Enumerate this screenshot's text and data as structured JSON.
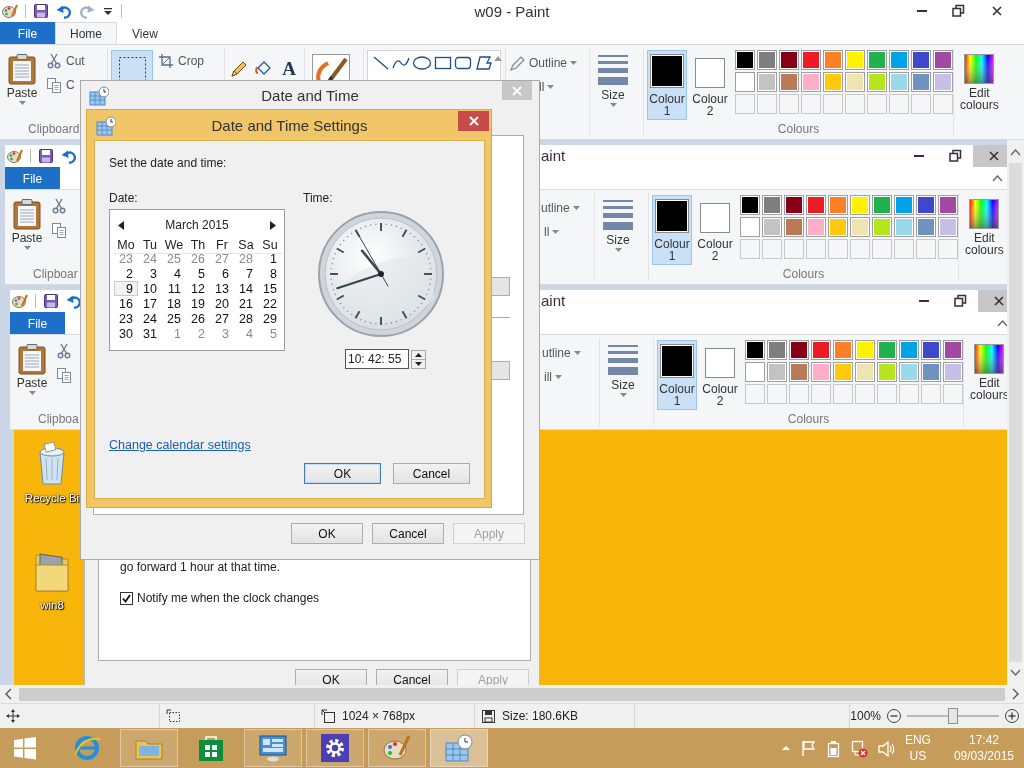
{
  "paint_window": {
    "title": "w09 - Paint",
    "tabs": [
      {
        "label": "File",
        "kind": "file",
        "selected": false
      },
      {
        "label": "Home",
        "kind": "tab",
        "selected": true
      },
      {
        "label": "View",
        "kind": "tab",
        "selected": false
      }
    ],
    "ribbon": {
      "paste": "Paste",
      "cut": "Cut",
      "copy": "C",
      "clipboard_label": "Clipboard",
      "select": {
        "selected": true
      },
      "crop": "Crop",
      "text_tool": "A",
      "outline": "Outline",
      "fill": "ll",
      "size": "Size",
      "colour_1": {
        "label": "Colour 1",
        "color": "#000000",
        "selected": true
      },
      "colour_2": {
        "label": "Colour 2",
        "color": "#ffffff",
        "selected": false
      },
      "edit_colours": "Edit colours",
      "colours_label": "Colours"
    }
  },
  "palette": [
    {
      "color": "#000000"
    },
    {
      "color": "#7f7f7f"
    },
    {
      "color": "#880015"
    },
    {
      "color": "#ed1c24"
    },
    {
      "color": "#ff7f27"
    },
    {
      "color": "#fff200"
    },
    {
      "color": "#22b14c"
    },
    {
      "color": "#00a2e8"
    },
    {
      "color": "#3f48cc"
    },
    {
      "color": "#a349a4"
    },
    {
      "color": "#ffffff"
    },
    {
      "color": "#c3c3c3"
    },
    {
      "color": "#b97a57"
    },
    {
      "color": "#ffaec9"
    },
    {
      "color": "#ffc90e"
    },
    {
      "color": "#efe4b0"
    },
    {
      "color": "#b5e61d"
    },
    {
      "color": "#99d9ea"
    },
    {
      "color": "#7092be"
    },
    {
      "color": "#c8bfe7"
    }
  ],
  "canvas_image": {
    "paint_windows": [
      {
        "title": "aint",
        "tabs": [
          {
            "label": "File",
            "kind": "file",
            "selected": false
          }
        ],
        "ribbon": {
          "paste": "Paste",
          "clipboard_label": "Clipboar",
          "outline": "utline",
          "fill": "ll",
          "size": "Size",
          "colour_1": {
            "label": "Colour 1",
            "color": "#000000",
            "selected": true
          },
          "colour_2": {
            "label": "Colour 2",
            "color": "#ffffff",
            "selected": false
          },
          "edit_colours": "Edit colours",
          "colours_label": "Colours"
        }
      },
      {
        "title": "aint",
        "tabs": [
          {
            "label": "File",
            "kind": "file",
            "selected": false
          }
        ],
        "ribbon": {
          "paste": "Paste",
          "clipboard_label": "Clipboa",
          "outline": "utline",
          "fill": "ill",
          "size": "Size",
          "colour_1": {
            "label": "Colour 1",
            "color": "#000000",
            "selected": true
          },
          "colour_2": {
            "label": "Colour 2",
            "color": "#ffffff",
            "selected": false
          },
          "edit_colours": "Edit colours",
          "colours_label": "Colours"
        }
      }
    ],
    "desktop_icons": [
      {
        "label": "Recycle Bi",
        "kind": "recycle-bin"
      },
      {
        "label": "win8",
        "kind": "folder"
      }
    ],
    "date_time_window": {
      "note": "go forward 1 hour at that time.",
      "notify": {
        "label": "Notify me when the clock changes",
        "checked": true
      },
      "buttons": [
        {
          "label": "OK",
          "disabled": false
        },
        {
          "label": "Cancel",
          "disabled": false
        },
        {
          "label": "Apply",
          "disabled": true
        }
      ]
    }
  },
  "date_time_dialog": {
    "title": "Date and Time",
    "buttons": [
      {
        "label": "OK",
        "disabled": false
      },
      {
        "label": "Cancel",
        "disabled": false
      },
      {
        "label": "Apply",
        "disabled": true
      }
    ]
  },
  "settings_dialog": {
    "title": "Date and Time Settings",
    "prompt": "Set the date and time:",
    "date_label": "Date:",
    "time_label": "Time:",
    "calendar": {
      "month": "March 2015",
      "weekdays": [
        "Mo",
        "Tu",
        "We",
        "Th",
        "Fr",
        "Sa",
        "Su"
      ],
      "days": [
        {
          "label": "23",
          "other_month": true,
          "selected": false
        },
        {
          "label": "24",
          "other_month": true,
          "selected": false
        },
        {
          "label": "25",
          "other_month": true,
          "selected": false
        },
        {
          "label": "26",
          "other_month": true,
          "selected": false
        },
        {
          "label": "27",
          "other_month": true,
          "selected": false
        },
        {
          "label": "28",
          "other_month": true,
          "selected": false
        },
        {
          "label": "1",
          "other_month": false,
          "selected": false
        },
        {
          "label": "2",
          "other_month": false,
          "selected": false
        },
        {
          "label": "3",
          "other_month": false,
          "selected": false
        },
        {
          "label": "4",
          "other_month": false,
          "selected": false
        },
        {
          "label": "5",
          "other_month": false,
          "selected": false
        },
        {
          "label": "6",
          "other_month": false,
          "selected": false
        },
        {
          "label": "7",
          "other_month": false,
          "selected": false
        },
        {
          "label": "8",
          "other_month": false,
          "selected": false
        },
        {
          "label": "9",
          "other_month": false,
          "selected": true
        },
        {
          "label": "10",
          "other_month": false,
          "selected": false
        },
        {
          "label": "11",
          "other_month": false,
          "selected": false
        },
        {
          "label": "12",
          "other_month": false,
          "selected": false
        },
        {
          "label": "13",
          "other_month": false,
          "selected": false
        },
        {
          "label": "14",
          "other_month": false,
          "selected": false
        },
        {
          "label": "15",
          "other_month": false,
          "selected": false
        },
        {
          "label": "16",
          "other_month": false,
          "selected": false
        },
        {
          "label": "17",
          "other_month": false,
          "selected": false
        },
        {
          "label": "18",
          "other_month": false,
          "selected": false
        },
        {
          "label": "19",
          "other_month": false,
          "selected": false
        },
        {
          "label": "20",
          "other_month": false,
          "selected": false
        },
        {
          "label": "21",
          "other_month": false,
          "selected": false
        },
        {
          "label": "22",
          "other_month": false,
          "selected": false
        },
        {
          "label": "23",
          "other_month": false,
          "selected": false
        },
        {
          "label": "24",
          "other_month": false,
          "selected": false
        },
        {
          "label": "25",
          "other_month": false,
          "selected": false
        },
        {
          "label": "26",
          "other_month": false,
          "selected": false
        },
        {
          "label": "27",
          "other_month": false,
          "selected": false
        },
        {
          "label": "28",
          "other_month": false,
          "selected": false
        },
        {
          "label": "29",
          "other_month": false,
          "selected": false
        },
        {
          "label": "30",
          "other_month": false,
          "selected": false
        },
        {
          "label": "31",
          "other_month": false,
          "selected": false
        },
        {
          "label": "1",
          "other_month": true,
          "selected": false
        },
        {
          "label": "2",
          "other_month": true,
          "selected": false
        },
        {
          "label": "3",
          "other_month": true,
          "selected": false
        },
        {
          "label": "4",
          "other_month": true,
          "selected": false
        },
        {
          "label": "5",
          "other_month": true,
          "selected": false
        }
      ]
    },
    "time": "10: 42: 55",
    "link": "Change calendar settings",
    "buttons": [
      {
        "label": "OK",
        "default": true
      },
      {
        "label": "Cancel",
        "default": false
      }
    ]
  },
  "status_bar": {
    "dimensions": "1024 × 768px",
    "size": "Size: 180.6KB",
    "zoom": "100%",
    "zoom_slider": {
      "level": 0.5
    }
  },
  "taskbar": {
    "apps": [
      {
        "kind": "browser",
        "running": false,
        "selected": false
      },
      {
        "kind": "explorer",
        "running": true,
        "selected": false
      },
      {
        "kind": "store",
        "running": false,
        "selected": false
      },
      {
        "kind": "control-panel",
        "running": true,
        "selected": false
      },
      {
        "kind": "settings",
        "running": true,
        "selected": false
      },
      {
        "kind": "paint",
        "running": true,
        "selected": false
      },
      {
        "kind": "date-time",
        "running": true,
        "selected": true
      }
    ],
    "language": "ENG",
    "region": "US",
    "time": "17:42",
    "date": "09/03/2015"
  }
}
